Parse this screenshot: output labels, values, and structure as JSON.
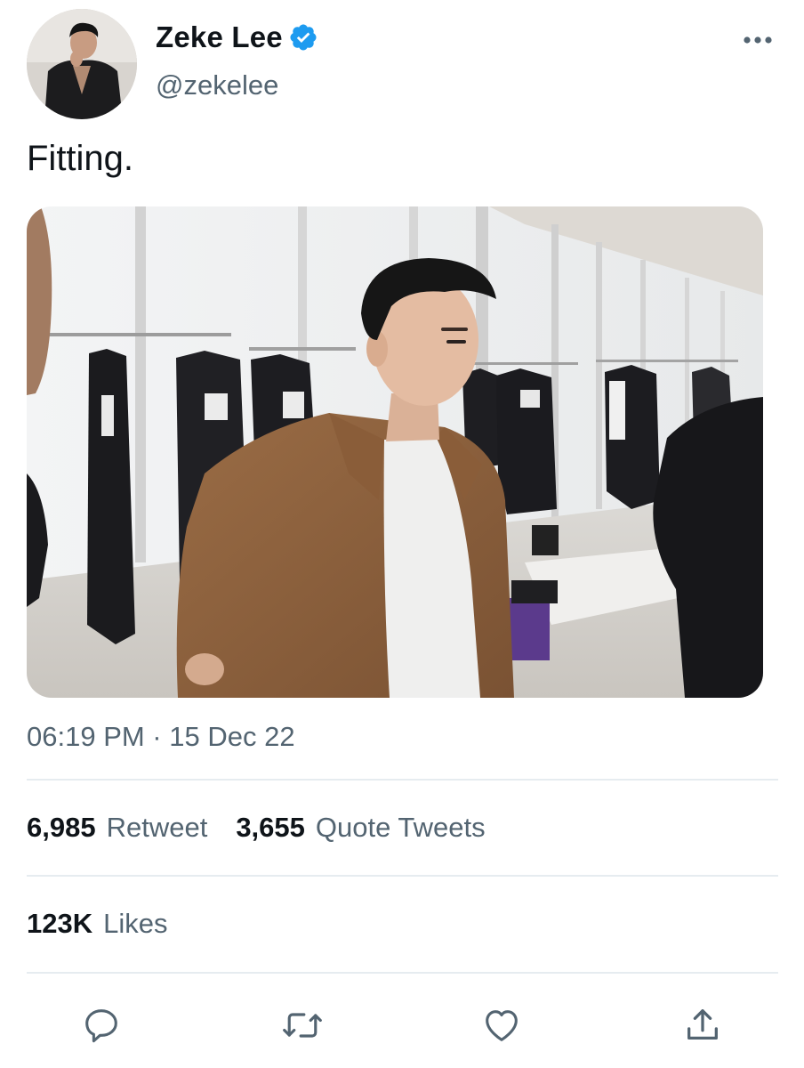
{
  "author": {
    "display_name": "Zeke Lee",
    "handle": "@zekelee",
    "verified": true,
    "avatar_icon": "avatar-photo"
  },
  "tweet": {
    "text": "Fitting.",
    "media_icon": "photo-man-in-suede-jacket-backstage",
    "timestamp": "06:19 PM · 15 Dec 22"
  },
  "stats": {
    "retweets": {
      "count": "6,985",
      "label": "Retweet"
    },
    "quotes": {
      "count": "3,655",
      "label": "Quote Tweets"
    },
    "likes": {
      "count": "123K",
      "label": "Likes"
    }
  },
  "actions": [
    {
      "name": "reply",
      "icon": "reply-icon"
    },
    {
      "name": "retweet",
      "icon": "retweet-icon"
    },
    {
      "name": "like",
      "icon": "heart-icon"
    },
    {
      "name": "share",
      "icon": "share-icon"
    }
  ],
  "colors": {
    "text_primary": "#0f1419",
    "text_secondary": "#536471",
    "verified_blue": "#1d9bf0",
    "divider": "#e6ecf0"
  }
}
